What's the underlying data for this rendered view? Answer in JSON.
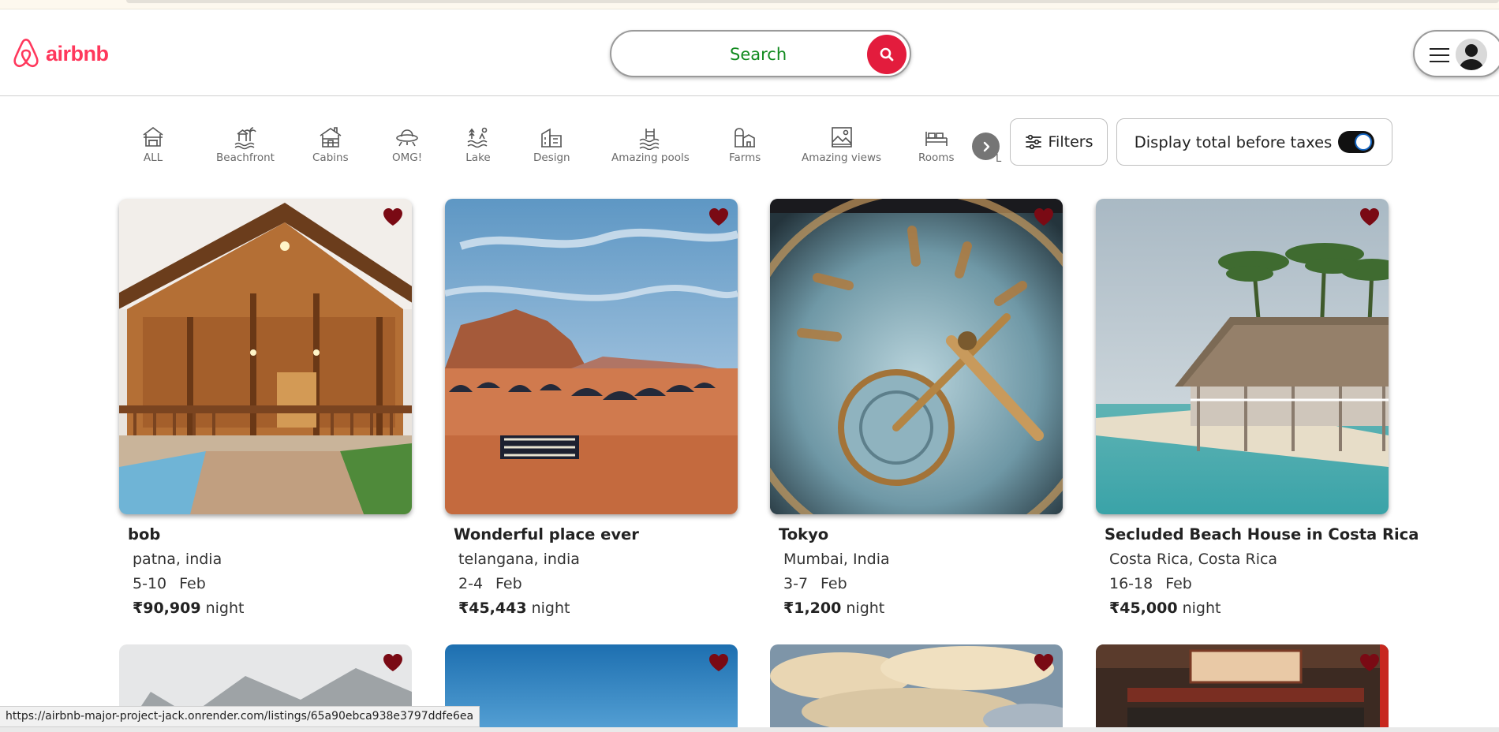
{
  "browser": {
    "status_url": "https://airbnb-major-project-jack.onrender.com/listings/65a90ebca938e3797ddfe6ea"
  },
  "navbar": {
    "brand": "airbnb",
    "brand_color": "#ff385c",
    "search_placeholder": "Search",
    "search_icon": "magnifier-icon",
    "menu_icon": "hamburger-icon",
    "avatar_icon": "user-avatar-icon"
  },
  "categories": [
    {
      "label": "ALL",
      "icon": "house-icon"
    },
    {
      "label": "Beachfront",
      "icon": "beach-icon"
    },
    {
      "label": "Cabins",
      "icon": "cabin-icon"
    },
    {
      "label": "OMG!",
      "icon": "ufo-icon"
    },
    {
      "label": "Lake",
      "icon": "lake-icon"
    },
    {
      "label": "Design",
      "icon": "design-icon"
    },
    {
      "label": "Amazing pools",
      "icon": "pool-icon"
    },
    {
      "label": "Farms",
      "icon": "farm-icon"
    },
    {
      "label": "Amazing views",
      "icon": "view-icon"
    },
    {
      "label": "Rooms",
      "icon": "bed-icon"
    }
  ],
  "categories_cut_label": "L",
  "filters": {
    "filters_label": "Filters",
    "tax_label": "Display total before taxes",
    "tax_toggle_on": true
  },
  "listings": [
    {
      "title": "bob",
      "location": "patna, india",
      "dates": "5-10",
      "month": "Feb",
      "price": "₹90,909",
      "unit": "night"
    },
    {
      "title": "Wonderful place ever",
      "location": "telangana, india",
      "dates": "2-4",
      "month": "Feb",
      "price": "₹45,443",
      "unit": "night"
    },
    {
      "title": "Tokyo",
      "location": "Mumbai, India",
      "dates": "3-7",
      "month": "Feb",
      "price": "₹1,200",
      "unit": "night"
    },
    {
      "title": "Secluded Beach House in Costa Rica",
      "location": "Costa Rica, Costa Rica",
      "dates": "16-18",
      "month": "Feb",
      "price": "₹45,000",
      "unit": "night"
    }
  ],
  "colors": {
    "heart": "#7a0a14",
    "search_button": "#e31c3d",
    "search_text": "#118a1f"
  }
}
